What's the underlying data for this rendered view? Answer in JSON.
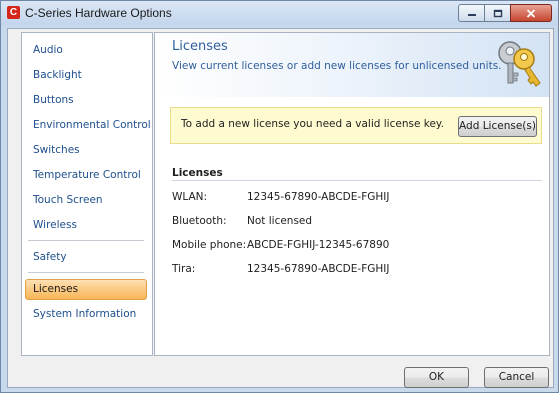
{
  "window": {
    "title": "C-Series Hardware Options",
    "app_icon_letter": "C",
    "controls": [
      "minimize",
      "maximize",
      "close"
    ]
  },
  "sidebar": {
    "items": [
      {
        "label": "Audio",
        "selected": false
      },
      {
        "label": "Backlight",
        "selected": false
      },
      {
        "label": "Buttons",
        "selected": false
      },
      {
        "label": "Environmental Control",
        "selected": false
      },
      {
        "label": "Switches",
        "selected": false
      },
      {
        "label": "Temperature Control",
        "selected": false
      },
      {
        "label": "Touch Screen",
        "selected": false
      },
      {
        "label": "Wireless",
        "selected": false
      },
      {
        "label": "Safety",
        "selected": false
      },
      {
        "label": "Licenses",
        "selected": true
      },
      {
        "label": "System Information",
        "selected": false
      }
    ]
  },
  "main": {
    "title": "Licenses",
    "description": "View current licenses or add new licenses for unlicensed units.",
    "header_icon": "keys-icon",
    "notice": {
      "text": "To add a new license you need a valid license key.",
      "button": "Add License(s)"
    },
    "licenses_section": {
      "title": "Licenses",
      "rows": [
        {
          "label": "WLAN:",
          "value": "12345-67890-ABCDE-FGHIJ"
        },
        {
          "label": "Bluetooth:",
          "value": "Not licensed"
        },
        {
          "label": "Mobile phone:",
          "value": "ABCDE-FGHIJ-12345-67890"
        },
        {
          "label": "Tira:",
          "value": "12345-67890-ABCDE-FGHIJ"
        }
      ]
    }
  },
  "footer": {
    "ok": "OK",
    "cancel": "Cancel"
  },
  "colors": {
    "accent_text": "#2f5f9c",
    "nav_link": "#1e4f8c",
    "selected_bg": "#f7b556",
    "notice_bg": "#fffbd0",
    "brand_red": "#d6261c"
  }
}
